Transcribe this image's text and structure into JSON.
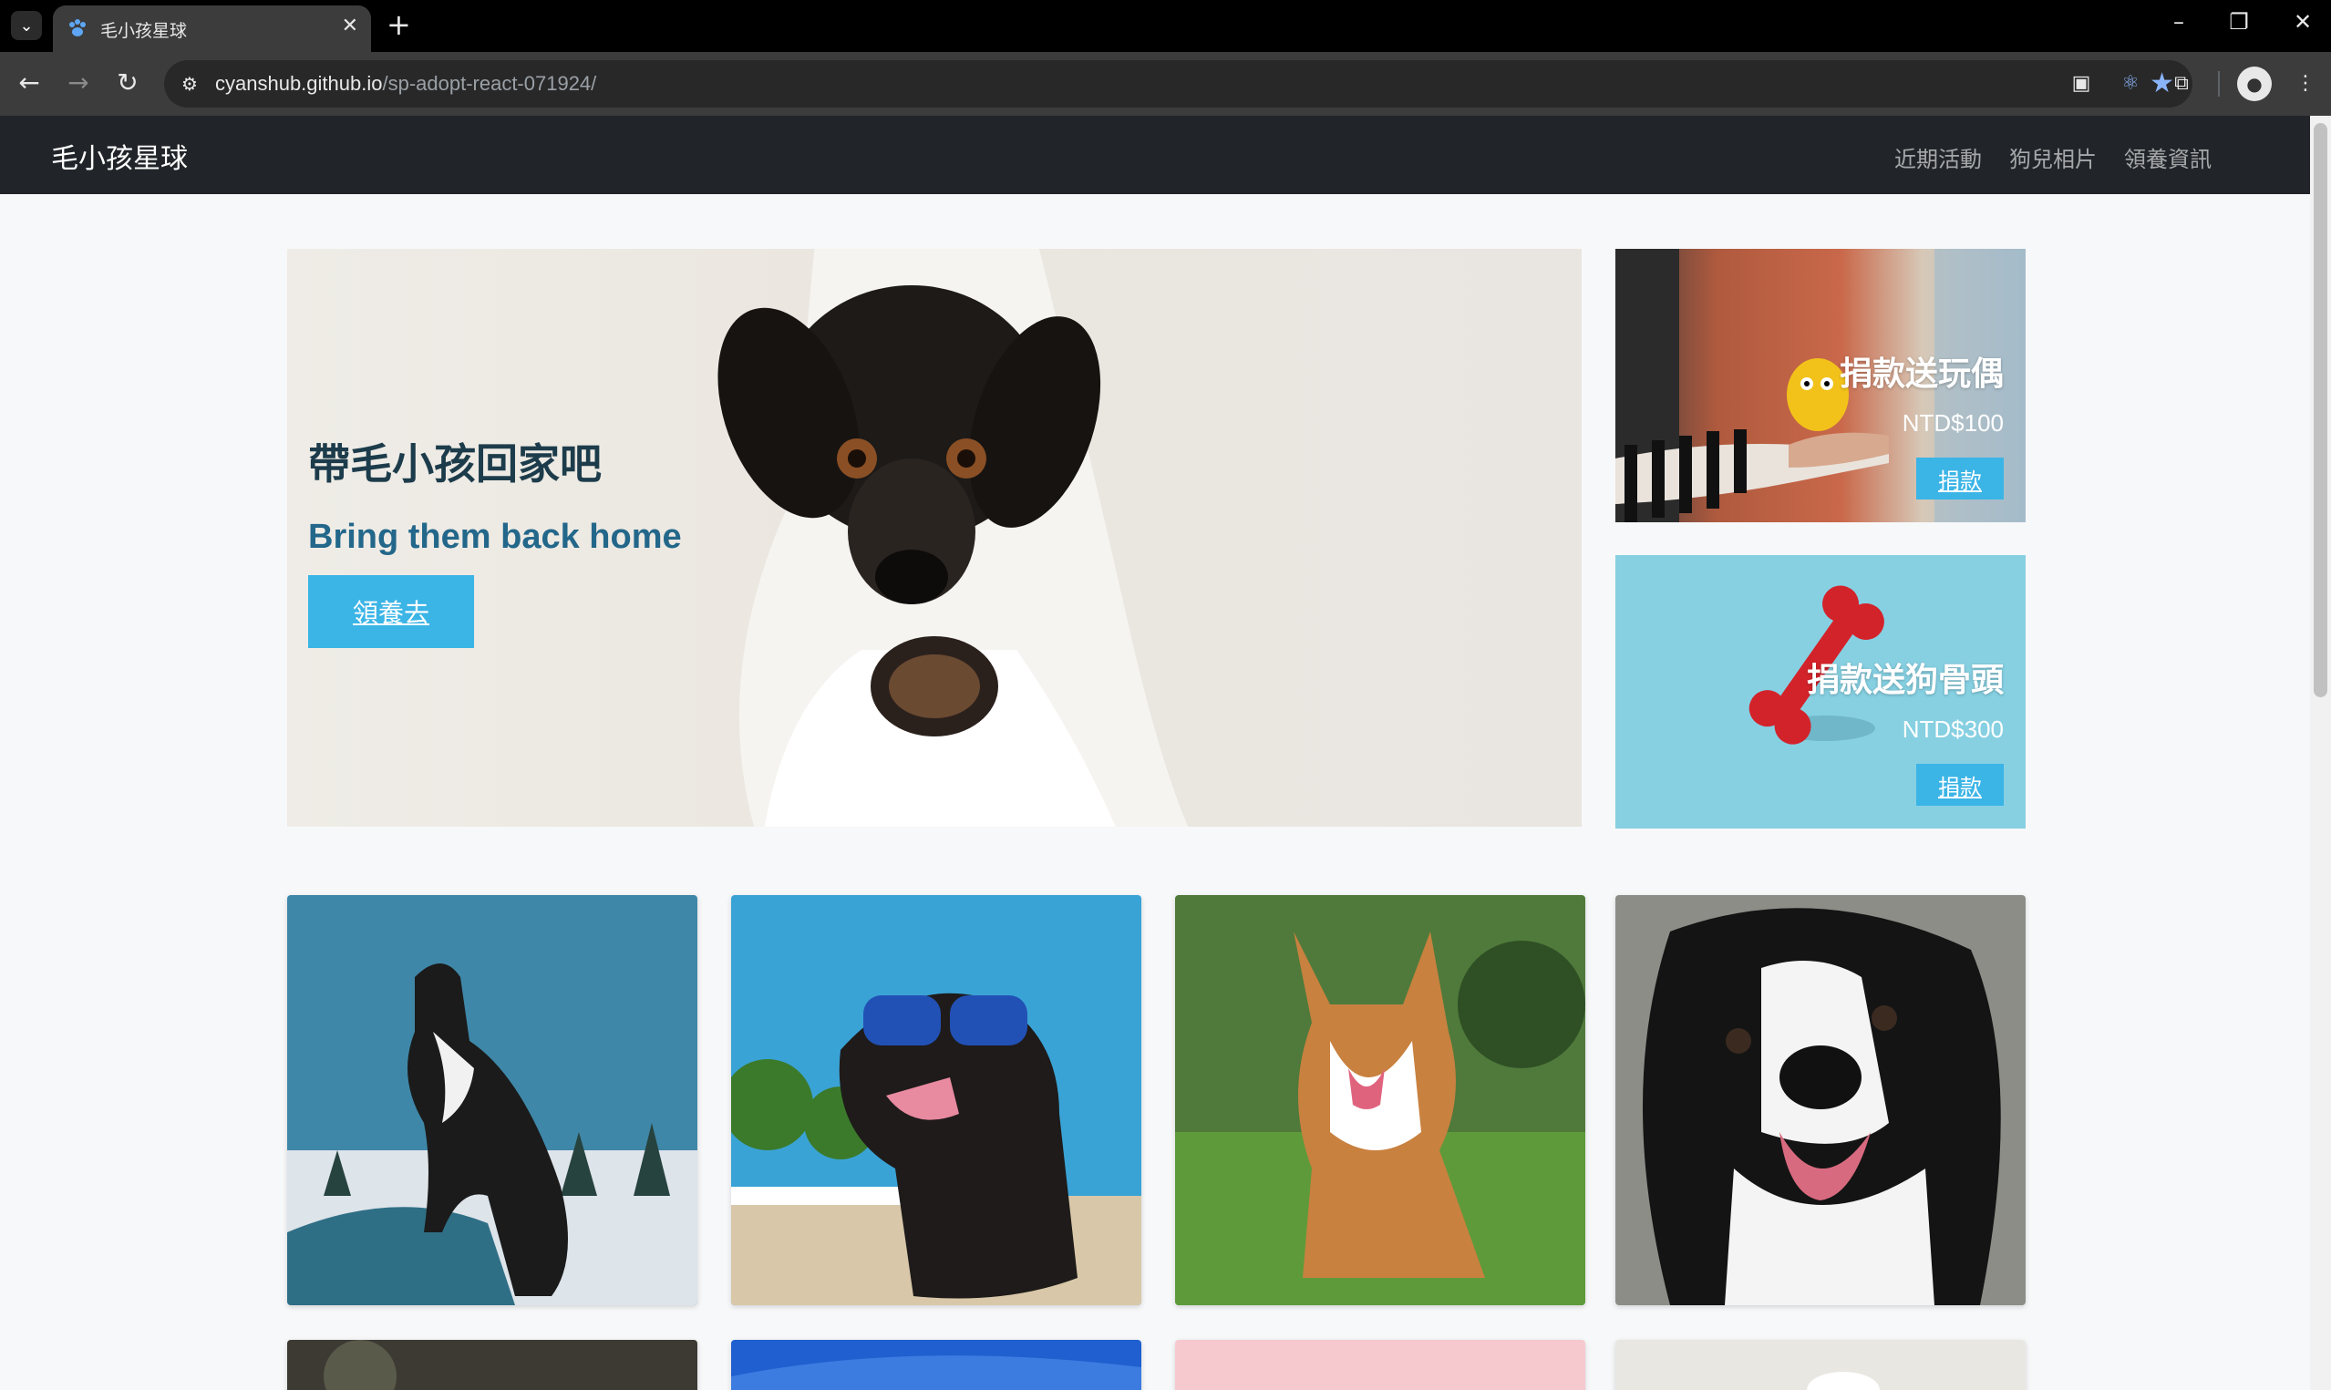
{
  "browser": {
    "tab_title": "毛小孩星球",
    "url_host": "cyanshub.github.io",
    "url_path": "/sp-adopt-react-071924/",
    "icons": [
      "chevron-down-icon",
      "paw-icon",
      "close-icon",
      "plus-icon",
      "minimize-icon",
      "restore-icon",
      "close-window-icon",
      "back-icon",
      "forward-icon",
      "reload-icon",
      "site-info-icon",
      "star-icon",
      "extension-icon",
      "react-devtools-icon",
      "puzzle-icon",
      "profile-avatar",
      "more-vert-icon"
    ]
  },
  "navbar": {
    "brand": "毛小孩星球",
    "links": [
      "近期活動",
      "狗兒相片",
      "領養資訊"
    ]
  },
  "hero": {
    "title": "帶毛小孩回家吧",
    "subtitle": "Bring them back home",
    "button": "領養去"
  },
  "promos": [
    {
      "title": "捐款送玩偶",
      "price": "NTD$100",
      "button": "捐款"
    },
    {
      "title": "捐款送狗骨頭",
      "price": "NTD$300",
      "button": "捐款"
    }
  ],
  "gallery_count_visible": 8,
  "colors": {
    "navbar_bg": "#212529",
    "accent": "#3bb4e6",
    "hero_title": "#1d3c4b",
    "hero_subtitle": "#23678a"
  }
}
